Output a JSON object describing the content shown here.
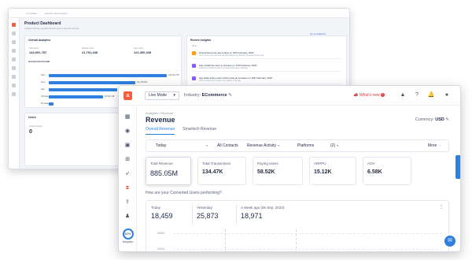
{
  "back": {
    "topbar_items": [
      "Live Mode",
      "Industry: ECommerce"
    ],
    "title": "Product Dashboard",
    "subtitle": "Analyse all key metrics across your customer funnel",
    "link": "Go to Analytics",
    "card_left_title": "Overall Analytics",
    "kpis": [
      {
        "label": "Total Users",
        "value": "143,091,787"
      },
      {
        "label": "Weekly Users",
        "value": "21,791,438"
      },
      {
        "label": "New Users",
        "value": "121,300,349"
      }
    ],
    "funnel_title": "Conversion Funnel",
    "funnel": [
      {
        "label": "Visit",
        "value": "143,091,787",
        "pct": 1.0
      },
      {
        "label": "View",
        "value": "101,238,901",
        "pct": 0.73
      },
      {
        "label": "Add",
        "value": "80,110,225",
        "pct": 0.58
      },
      {
        "label": "Checkout",
        "value": "62,510,118",
        "pct": 0.46
      },
      {
        "label": "Purchase",
        "value": "",
        "pct": 0.04
      }
    ],
    "card_right_title": "Recent Insights",
    "insights_label": "New",
    "insights": [
      {
        "title": "Overall Revenue saw a drop on 10th February, 2022",
        "desc": "Your revenue from web and iOS has dropped significantly compared to last week",
        "color": "#ff9f1c"
      },
      {
        "title": "App install has seen a increase on 14th February, 2022",
        "desc": "Installs from Android platform increased after latest campaign",
        "color": "#8a5cf5"
      },
      {
        "title": "App Daily active users (DAU) saw an increase on 16th February, 2022",
        "desc": "DAU increased by 12% after new release of the app",
        "color": "#8a5cf5"
      }
    ],
    "bottom_card_title": "Users",
    "bottom_kpi_label": "Active Users",
    "bottom_kpi_value": "0"
  },
  "front": {
    "logo": "a",
    "mode": "Live Mode",
    "industry_label": "Industry:",
    "industry_value": "ECommerce",
    "whats_new": "What's new",
    "whats_new_count": "1",
    "breadcrumb": "Analytics  /  Revenue",
    "title": "Revenue",
    "currency_label": "Currency:",
    "currency_value": "USD",
    "tabs": [
      "Overall Revenue",
      "Smartech Revenue"
    ],
    "filters": {
      "period": "Today",
      "contacts": "All Contacts",
      "activity": "Revenue Activity",
      "platforms": "Platforms",
      "platforms_count": "(2)",
      "more": "More"
    },
    "kpis": [
      {
        "label": "Total Revenue",
        "value": "885.05M"
      },
      {
        "label": "Total Transactions",
        "value": "134.47K"
      },
      {
        "label": "Paying Users",
        "value": "58.52K"
      },
      {
        "label": "ARPPU",
        "value": "15.12K"
      },
      {
        "label": "AOV",
        "value": "6.58K"
      }
    ],
    "question": "How are your Converted Users performing?",
    "perf": [
      {
        "label": "Today",
        "value": "18,459"
      },
      {
        "label": "Yesterday",
        "value": "25,873"
      },
      {
        "label": "A Week ago (08 Sep, 2023)",
        "value": "18,971"
      }
    ],
    "y_ticks": [
      "2500",
      "2000"
    ],
    "adoption_pct": "82%",
    "adoption_label": "Adoption"
  }
}
